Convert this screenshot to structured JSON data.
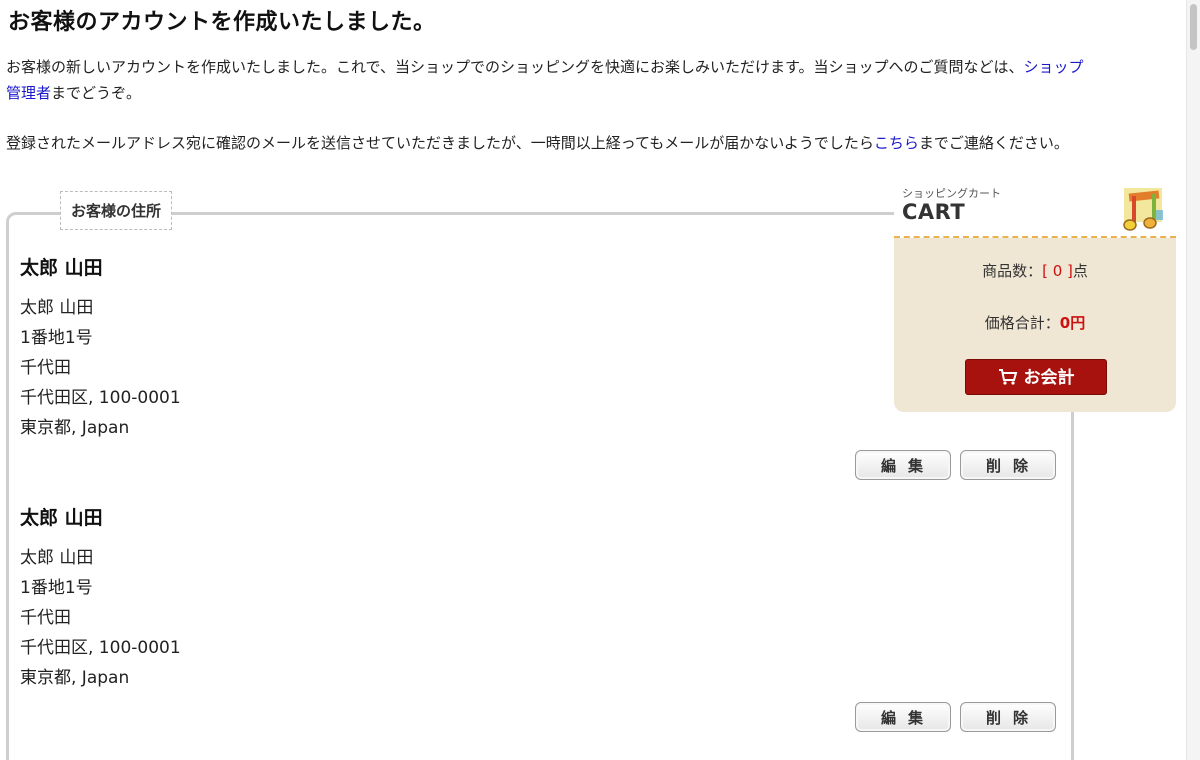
{
  "page": {
    "title": "お客様のアカウントを作成いたしました。",
    "intro_text": "お客様の新しいアカウントを作成いたしました。これで、当ショップでのショッピングを快適にお楽しみいただけます。当ショップへのご質問などは、",
    "intro_link": "ショップ管理者",
    "intro_tail": "までどうぞ。",
    "mail_text": "登録されたメールアドレス宛に確認のメールを送信させていただきましたが、一時間以上経ってもメールが届かないようでしたら",
    "mail_link": "こちら",
    "mail_tail": "までご連絡ください。"
  },
  "addresses": {
    "legend": "お客様の住所",
    "items": [
      {
        "name": "太郎 山田",
        "lines": [
          "太郎 山田",
          "1番地1号",
          "千代田",
          "千代田区, 100-0001",
          "東京都, Japan"
        ],
        "edit_label": "編集",
        "delete_label": "削除"
      },
      {
        "name": "太郎 山田",
        "lines": [
          "太郎 山田",
          "1番地1号",
          "千代田",
          "千代田区, 100-0001",
          "東京都, Japan"
        ],
        "edit_label": "編集",
        "delete_label": "削除"
      }
    ]
  },
  "cart": {
    "subtitle": "ショッピングカート",
    "title": "CART",
    "icon": "music-notes-icon",
    "count_label": "商品数：",
    "count_value": "[ 0 ]",
    "count_unit": "点",
    "total_label": "価格合計：",
    "total_value": "0円",
    "checkout_label": "お会計",
    "accent_color": "#a8120e",
    "background_color": "#efe6d4"
  }
}
